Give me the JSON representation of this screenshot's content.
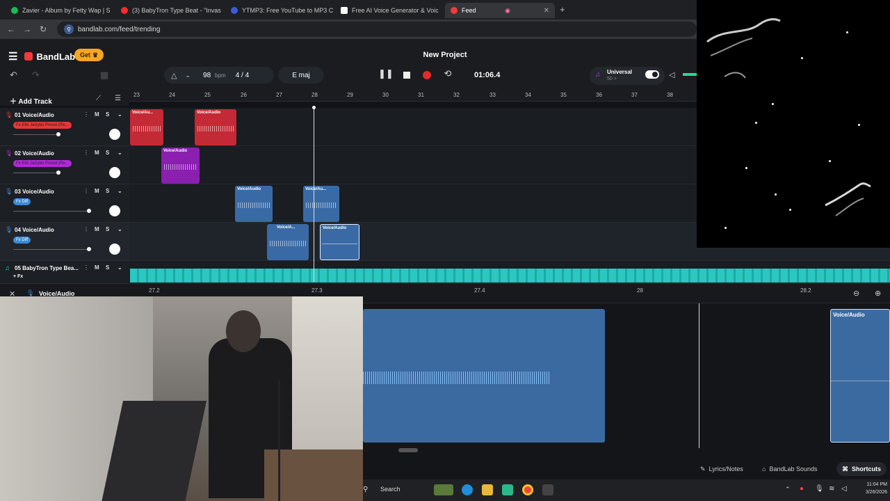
{
  "browser": {
    "tabs": [
      {
        "label": "Zavier - Album by Fetty Wap | S",
        "color": "#1db954"
      },
      {
        "label": "(3) BabyTron Type Beat - \"Invas",
        "color": "#ff2a2a"
      },
      {
        "label": "YTMP3: Free YouTube to MP3 C",
        "color": "#3a5bd9"
      },
      {
        "label": "Free AI Voice Generator & Voic",
        "color": "#ffffff"
      },
      {
        "label": "Feed",
        "color": "#f23a3a"
      }
    ],
    "url": "bandlab.com/feed/trending"
  },
  "app": {
    "brand": "BandLab",
    "get_label": "Get",
    "project_title": "New Project",
    "bpm_value": "98",
    "bpm_unit": "bpm",
    "time_signature": "4 / 4",
    "key": "E maj",
    "time": "01:06.4",
    "universal_label": "Universal",
    "universal_sub": "50 >",
    "add_track_label": "Add Track"
  },
  "ruler": [
    "23",
    "24",
    "25",
    "26",
    "27",
    "28",
    "29",
    "30",
    "31",
    "32",
    "33",
    "34",
    "35",
    "36",
    "37",
    "38"
  ],
  "tracks": [
    {
      "name": "01 Voice/Audio",
      "fx": "Fx Etik Jaizybo Preset (Re...",
      "fx_color": "#e23a3a",
      "icon_color": "#e23a3a"
    },
    {
      "name": "02 Voice/Audio",
      "fx": "Fx Etik Jaizybo Preset (Re...",
      "fx_color": "#b02ad8",
      "icon_color": "#b02ad8"
    },
    {
      "name": "03 Voice/Audio",
      "fx": "Fx Diff",
      "fx_color": "#3a8ad8",
      "icon_color": "#3a8ad8"
    },
    {
      "name": "04 Voice/Audio",
      "fx": "Fx Diff",
      "fx_color": "#3a8ad8",
      "icon_color": "#3a8ad8"
    },
    {
      "name": "05 BabyTron Type Bea...",
      "fx": "+ Fx",
      "fx_color": "",
      "icon_color": "#2ad8c0"
    }
  ],
  "mute_label": "M",
  "solo_label": "S",
  "clip_label": "Voice/Audio",
  "clip_label_short": "Voice/Au...",
  "clip_label_short2": "Voice/A...",
  "editor": {
    "track_name": "Voice/Audio",
    "ticks": [
      "27.2",
      "27.3",
      "27.4",
      "28",
      "28.2"
    ],
    "clip_label": "Voice/Audio",
    "lyrics_label": "Lyrics/Notes",
    "sounds_label": "BandLab Sounds",
    "shortcuts_label": "Shortcuts"
  },
  "taskbar": {
    "search_label": "Search",
    "time": "11:04 PM",
    "date": "3/26/2026"
  }
}
